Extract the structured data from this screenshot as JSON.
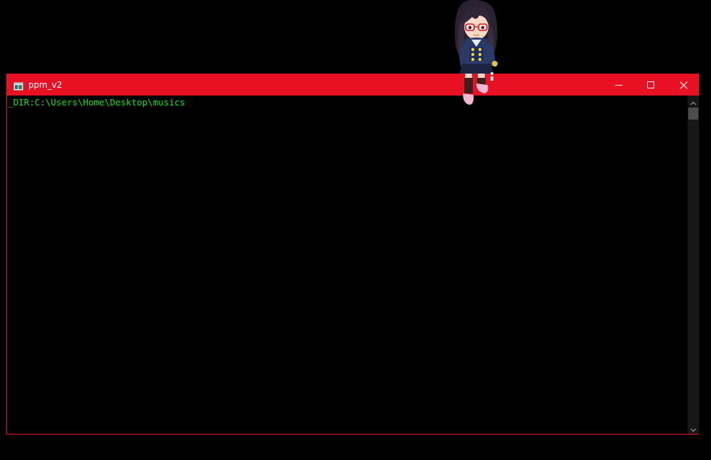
{
  "window": {
    "title": "ppm_v2",
    "accent_color": "#e81123"
  },
  "title_controls": {
    "minimize_icon": "minimize-icon",
    "maximize_icon": "maximize-icon",
    "close_icon": "close-icon"
  },
  "console": {
    "lines": [
      "_DIR:C:\\Users\\Home\\Desktop\\musics"
    ],
    "text_color": "#13e213"
  },
  "scrollbar": {
    "up_icon": "chevron-up-icon",
    "down_icon": "chevron-down-icon"
  },
  "desktop": {
    "mascot": "desktop-mascot-character"
  }
}
